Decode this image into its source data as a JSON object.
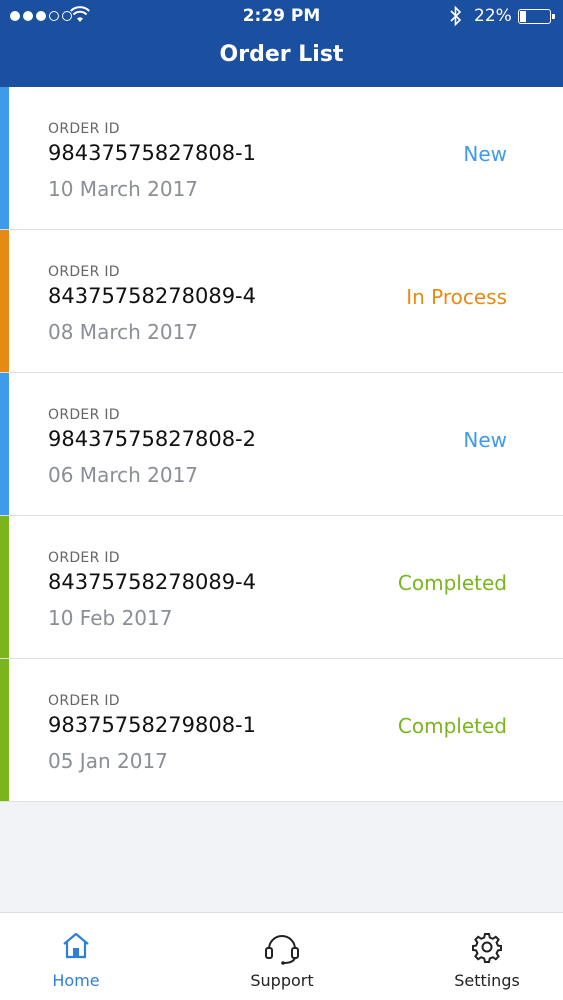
{
  "status_bar": {
    "time": "2:29 PM",
    "battery_percent": "22%",
    "battery_level": 0.22
  },
  "header": {
    "title": "Order List"
  },
  "colors": {
    "header_bg": "#1b4fa0",
    "new": "#3d9be9",
    "in_process": "#e58a14",
    "completed": "#7ab51d",
    "active_tab": "#2f7fd6"
  },
  "orders": [
    {
      "label": "ORDER ID",
      "id": "98437575827808-1",
      "date": "10 March 2017",
      "status": "New",
      "status_color": "#3d9be9"
    },
    {
      "label": "ORDER ID",
      "id": "84375758278089-4",
      "date": "08 March 2017",
      "status": "In Process",
      "status_color": "#e58a14"
    },
    {
      "label": "ORDER ID",
      "id": "98437575827808-2",
      "date": "06 March 2017",
      "status": "New",
      "status_color": "#3d9be9"
    },
    {
      "label": "ORDER ID",
      "id": "84375758278089-4",
      "date": "10 Feb 2017",
      "status": "Completed",
      "status_color": "#7ab51d"
    },
    {
      "label": "ORDER ID",
      "id": "98375758279808-1",
      "date": "05 Jan 2017",
      "status": "Completed",
      "status_color": "#7ab51d"
    }
  ],
  "tabs": [
    {
      "label": "Home",
      "icon": "home-icon",
      "active": true
    },
    {
      "label": "Support",
      "icon": "headset-icon",
      "active": false
    },
    {
      "label": "Settings",
      "icon": "gear-icon",
      "active": false
    }
  ]
}
